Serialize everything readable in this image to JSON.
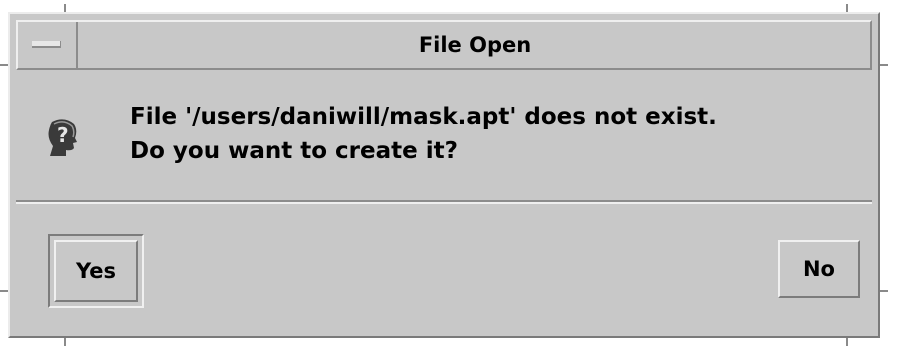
{
  "window": {
    "title": "File Open"
  },
  "dialog": {
    "icon": "question-head-icon",
    "message_line1": "File '/users/daniwill/mask.apt' does not exist.",
    "message_line2": "Do you want to create it?"
  },
  "buttons": {
    "yes_label": "Yes",
    "no_label": "No"
  },
  "colors": {
    "background": "#c8c8c8",
    "highlight": "#efefef",
    "shadow": "#8c8c8c",
    "text": "#000000"
  }
}
